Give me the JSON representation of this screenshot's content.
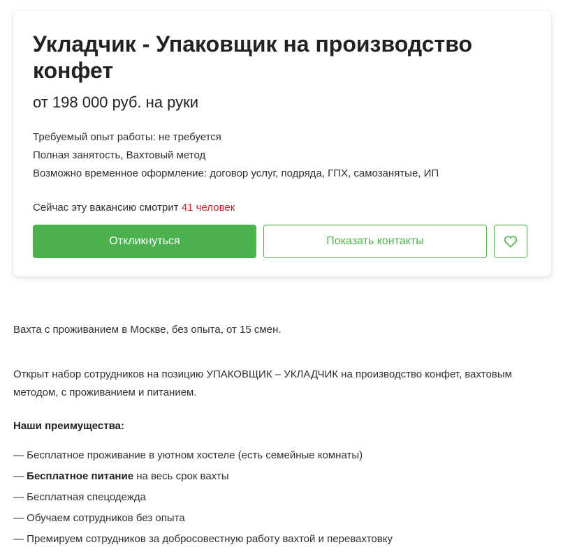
{
  "vacancy": {
    "title": "Укладчик - Упаковщик на производство конфет",
    "salary": "от 198 000 руб. на руки",
    "experience": "Требуемый опыт работы: не требуется",
    "employment": "Полная занятость, Вахтовый метод",
    "contract": "Возможно временное оформление: договор услуг, подряда, ГПХ, самозанятые, ИП",
    "watching_prefix": "Сейчас эту вакансию смотрит ",
    "watching_count": "41 человек"
  },
  "actions": {
    "respond_label": "Откликнуться",
    "contacts_label": "Показать контакты",
    "favorite_icon": "heart-icon"
  },
  "description": {
    "intro": "Вахта с проживанием в Москве, без опыта, от 15 смен.",
    "recruiting": "Открыт набор сотрудников на позицию УПАКОВЩИК – УКЛАДЧИК на производство конфет, вахтовым методом, с проживанием и питанием.",
    "advantages_heading": "Наши преимущества:",
    "advantages": [
      {
        "dash": "— ",
        "bold": "",
        "text": "Бесплатное проживание в уютном хостеле (есть семейные комнаты)"
      },
      {
        "dash": "— ",
        "bold": "Бесплатное питание",
        "text": " на весь срок вахты"
      },
      {
        "dash": "— ",
        "bold": "",
        "text": "Бесплатная спецодежда"
      },
      {
        "dash": "— ",
        "bold": "",
        "text": "Обучаем сотрудников без опыта"
      },
      {
        "dash": "— ",
        "bold": "",
        "text": "Премируем сотрудников за добросовестную работу вахтой и перевахтовку"
      }
    ]
  },
  "colors": {
    "accent_green": "#4bb24e",
    "watching_red": "#c0222b"
  }
}
